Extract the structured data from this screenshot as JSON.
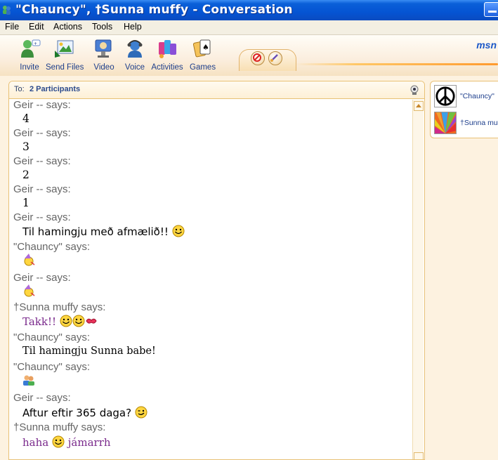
{
  "window": {
    "title": "\"Chauncy\", †Sunna muffy - Conversation"
  },
  "menu": [
    "File",
    "Edit",
    "Actions",
    "Tools",
    "Help"
  ],
  "toolbar": {
    "buttons": [
      {
        "label": "Invite",
        "icon": "invite-icon"
      },
      {
        "label": "Send Files",
        "icon": "send-files-icon"
      },
      {
        "label": "Video",
        "icon": "video-icon"
      },
      {
        "label": "Voice",
        "icon": "voice-icon"
      },
      {
        "label": "Activities",
        "icon": "activities-icon"
      },
      {
        "label": "Games",
        "icon": "games-icon"
      }
    ],
    "brand": "msn"
  },
  "conversation": {
    "to_label": "To:",
    "to_value": "2 Participants",
    "messages": [
      {
        "sender": "Geir -- says:",
        "text": "4"
      },
      {
        "sender": "Geir -- says:",
        "text": "3"
      },
      {
        "sender": "Geir -- says:",
        "text": "2"
      },
      {
        "sender": "Geir -- says:",
        "text": "1"
      },
      {
        "sender": "Geir -- says:",
        "text": "Til hamingju með afmælið!!",
        "emoticons": [
          "smile-emoticon"
        ]
      },
      {
        "sender": "\"Chauncy\" says:",
        "text": "",
        "emoticons": [
          "party-emoticon"
        ]
      },
      {
        "sender": "Geir -- says:",
        "text": "",
        "emoticons": [
          "party-emoticon"
        ]
      },
      {
        "sender": "†Sunna muffy says:",
        "text": "Takk!!",
        "emoticons": [
          "smile-emoticon",
          "smile-emoticon",
          "kiss-emoticon"
        ]
      },
      {
        "sender": "\"Chauncy\" says:",
        "text": "Til hamingju Sunna babe!"
      },
      {
        "sender": "\"Chauncy\" says:",
        "text": "",
        "emoticons": [
          "people-emoticon"
        ]
      },
      {
        "sender": "Geir -- says:",
        "text": "Aftur eftir 365 daga?",
        "emoticons": [
          "wink-emoticon"
        ]
      },
      {
        "sender": "†Sunna muffy says:",
        "text": "haha",
        "text2": "jámarrh",
        "emoticons": [
          "smile-emoticon"
        ]
      }
    ]
  },
  "participants": [
    {
      "name": "\"Chauncy\"",
      "avatar": "peace-sign-avatar"
    },
    {
      "name": "†Sunna muf",
      "avatar": "colorful-flower-avatar"
    }
  ],
  "colors": {
    "titlebar": "#0554d3",
    "sunna_text": "#7a2a8c",
    "sender_text": "#666666",
    "toolbar_text": "#1d3e8c"
  }
}
